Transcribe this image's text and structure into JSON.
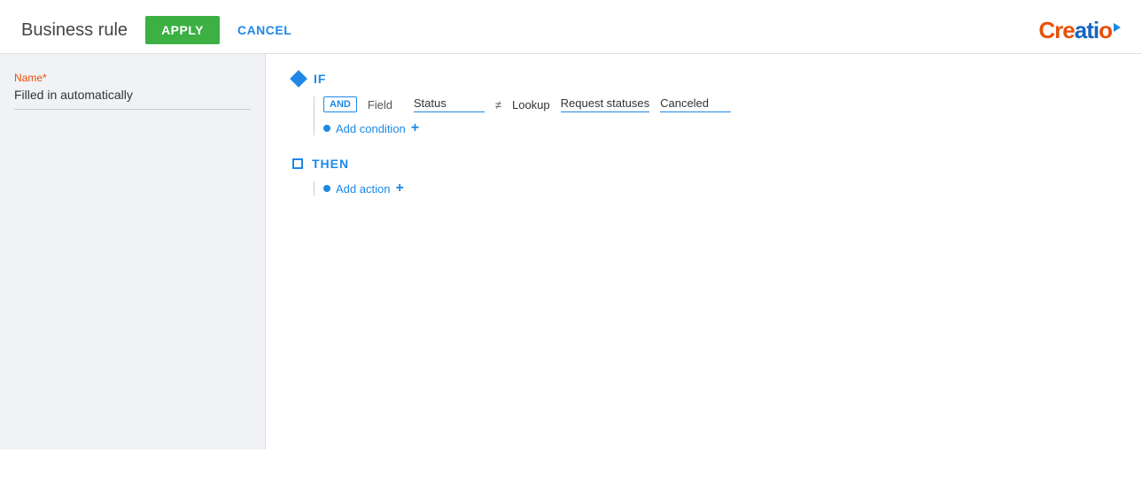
{
  "header": {
    "title": "Business rule",
    "apply_label": "APPLY",
    "cancel_label": "CANCEL"
  },
  "logo": {
    "text_orange": "Creatio",
    "text": "Creatio"
  },
  "sidebar": {
    "field_label": "Name*",
    "field_value": "Filled in automatically"
  },
  "rule": {
    "if_keyword": "IF",
    "then_keyword": "THEN",
    "and_label": "AND",
    "condition": {
      "field_label": "Field",
      "field_value": "Status",
      "operator": "≠",
      "type_label": "Lookup",
      "lookup_source": "Request statuses",
      "result_value": "Canceled"
    },
    "add_condition_label": "Add condition",
    "add_action_label": "Add action"
  }
}
